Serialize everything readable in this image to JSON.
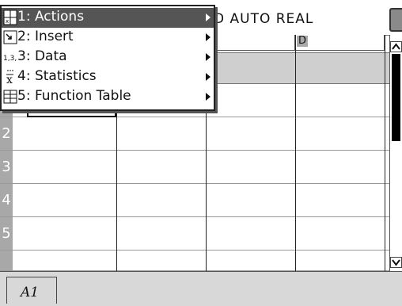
{
  "status_bar": {
    "mode_text": "D AUTO REAL"
  },
  "menu": {
    "items": [
      {
        "label": "1: Actions",
        "icon": "actions-icon",
        "selected": true
      },
      {
        "label": "2: Insert",
        "icon": "insert-icon"
      },
      {
        "label": "3: Data",
        "icon": "data-icon"
      },
      {
        "label": "4: Statistics",
        "icon": "statistics-icon"
      },
      {
        "label": "5: Function Table",
        "icon": "function-table-icon"
      }
    ]
  },
  "sheet": {
    "visible_column_letters": [
      "D"
    ],
    "row_numbers": [
      "1",
      "2",
      "3",
      "4",
      "5"
    ],
    "selected_cell": "A1"
  },
  "entry_bar": {
    "cell_reference": "A1"
  },
  "colors": {
    "menu_highlight": "#555555",
    "header_gray": "#a8a8a8",
    "formula_row": "#cfcfcf"
  }
}
